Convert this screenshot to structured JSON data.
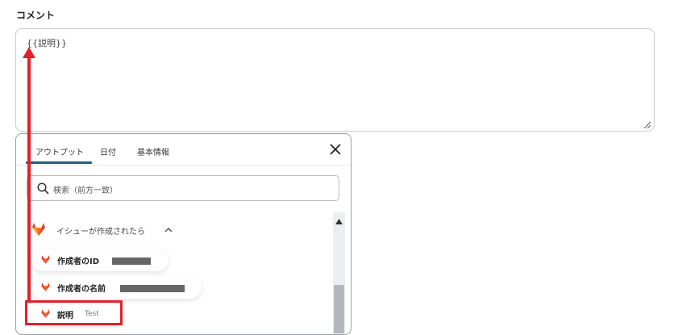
{
  "comment": {
    "label": "コメント",
    "value": "{{説明}}"
  },
  "popup": {
    "tabs": [
      {
        "label": "アウトプット",
        "active": true
      },
      {
        "label": "日付"
      },
      {
        "label": "基本情報"
      }
    ],
    "search_placeholder": "検索（前方一致）",
    "group_title": "イシューが作成されたら",
    "items": [
      {
        "label": "作成者のID"
      },
      {
        "label": "作成者の名前"
      },
      {
        "label": "説明",
        "sample": "Test"
      }
    ]
  },
  "colors": {
    "accent": "#1f5f7a",
    "annotation_red": "#e0212c",
    "gitlab_orange": "#e2432a"
  },
  "icons": [
    "search-icon",
    "close-icon",
    "gitlab-icon",
    "chevron-up-icon",
    "resize-handle-icon",
    "scroll-up-icon"
  ]
}
